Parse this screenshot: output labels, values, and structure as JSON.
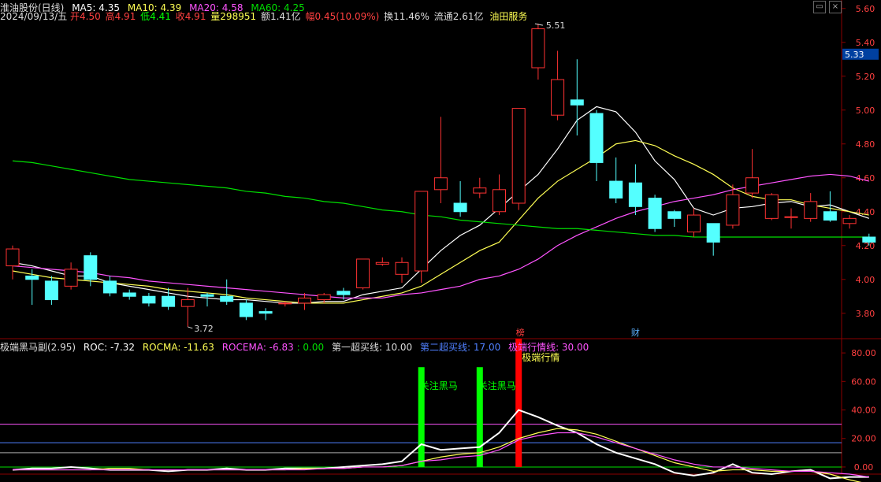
{
  "header": {
    "stock_name": "淮油股份(日线)",
    "ma5": "MA5: 4.35",
    "ma10": "MA10: 4.39",
    "ma20": "MA20: 4.58",
    "ma60": "MA60: 4.25",
    "date": "2024/09/13/五",
    "open": "开4.50",
    "high": "高4.91",
    "low": "低4.41",
    "close": "收4.91",
    "volume": "量298951",
    "amount": "额1.41亿",
    "change": "幅0.45(10.09%)",
    "turnover": "换11.46%",
    "float_cap": "流通2.61亿",
    "sector": "油田服务"
  },
  "indicator_header": {
    "name": "极端黑马副(2.95)",
    "roc": "ROC: -7.32",
    "rocma": "ROCMA: -11.63",
    "rocema": "ROCEMA: -6.83",
    "zero": ": 0.00",
    "first_buy": "第一超买线: 10.00",
    "second_buy": "第二超买线: 17.00",
    "extreme": "极端行情线: 30.00"
  },
  "price_axis_labels": [
    "5.60",
    "5.40",
    "5.20",
    "5.00",
    "4.80",
    "4.60",
    "4.40",
    "4.20",
    "4.00",
    "3.80"
  ],
  "indicator_axis_labels": [
    "80.00",
    "60.00",
    "40.00",
    "20.00",
    "0.00"
  ],
  "current_price_tag": "5.33",
  "annotations": {
    "high_label": "5.51",
    "low_label": "3.72",
    "marker_bang": "榜",
    "marker_cai": "财",
    "signal_1": "关注黑马",
    "signal_2": "关注黑马",
    "signal_3": "极端行情"
  },
  "colors": {
    "bg": "#000000",
    "up": "#ff3232",
    "down": "#54ffff",
    "ma5": "#ffffff",
    "ma10": "#ffff54",
    "ma20": "#ff54ff",
    "ma60": "#00e000",
    "grid": "#8b0000",
    "axis_text": "#ff4040",
    "title_text": "#dddddd"
  },
  "chart_data": [
    {
      "type": "candlestick",
      "title": "淮油股份(日线)",
      "ylim": [
        3.65,
        5.65
      ],
      "candles": [
        {
          "o": 4.08,
          "c": 4.18,
          "h": 4.2,
          "l": 4.0
        },
        {
          "o": 4.02,
          "c": 4.0,
          "h": 4.06,
          "l": 3.85
        },
        {
          "o": 3.99,
          "c": 3.88,
          "h": 4.02,
          "l": 3.85
        },
        {
          "o": 3.96,
          "c": 4.06,
          "h": 4.1,
          "l": 3.94
        },
        {
          "o": 4.14,
          "c": 4.0,
          "h": 4.16,
          "l": 3.96
        },
        {
          "o": 3.99,
          "c": 3.92,
          "h": 4.02,
          "l": 3.9
        },
        {
          "o": 3.92,
          "c": 3.9,
          "h": 3.94,
          "l": 3.88
        },
        {
          "o": 3.9,
          "c": 3.86,
          "h": 3.92,
          "l": 3.84
        },
        {
          "o": 3.9,
          "c": 3.84,
          "h": 3.95,
          "l": 3.82
        },
        {
          "o": 3.84,
          "c": 3.88,
          "h": 3.95,
          "l": 3.72
        },
        {
          "o": 3.91,
          "c": 3.9,
          "h": 3.92,
          "l": 3.84
        },
        {
          "o": 3.9,
          "c": 3.87,
          "h": 4.0,
          "l": 3.85
        },
        {
          "o": 3.86,
          "c": 3.78,
          "h": 3.88,
          "l": 3.76
        },
        {
          "o": 3.81,
          "c": 3.8,
          "h": 3.83,
          "l": 3.76
        },
        {
          "o": 3.86,
          "c": 3.86,
          "h": 3.87,
          "l": 3.84
        },
        {
          "o": 3.86,
          "c": 3.89,
          "h": 3.92,
          "l": 3.82
        },
        {
          "o": 3.88,
          "c": 3.91,
          "h": 3.92,
          "l": 3.86
        },
        {
          "o": 3.93,
          "c": 3.91,
          "h": 3.95,
          "l": 3.88
        },
        {
          "o": 3.95,
          "c": 4.12,
          "h": 4.12,
          "l": 3.94
        },
        {
          "o": 4.09,
          "c": 4.1,
          "h": 4.13,
          "l": 4.08
        },
        {
          "o": 4.03,
          "c": 4.1,
          "h": 4.13,
          "l": 3.98
        },
        {
          "o": 4.05,
          "c": 4.52,
          "h": 4.52,
          "l": 3.98
        },
        {
          "o": 4.53,
          "c": 4.6,
          "h": 4.96,
          "l": 4.45
        },
        {
          "o": 4.45,
          "c": 4.4,
          "h": 4.58,
          "l": 4.37
        },
        {
          "o": 4.51,
          "c": 4.54,
          "h": 4.6,
          "l": 4.48
        },
        {
          "o": 4.4,
          "c": 4.53,
          "h": 4.62,
          "l": 4.38
        },
        {
          "o": 4.45,
          "c": 5.01,
          "h": 5.01,
          "l": 4.41
        },
        {
          "o": 5.25,
          "c": 5.48,
          "h": 5.51,
          "l": 5.18
        },
        {
          "o": 4.97,
          "c": 5.18,
          "h": 5.35,
          "l": 4.94
        },
        {
          "o": 5.06,
          "c": 5.03,
          "h": 5.3,
          "l": 4.85
        },
        {
          "o": 4.98,
          "c": 4.69,
          "h": 5.0,
          "l": 4.58
        },
        {
          "o": 4.58,
          "c": 4.48,
          "h": 4.72,
          "l": 4.45
        },
        {
          "o": 4.57,
          "c": 4.43,
          "h": 4.68,
          "l": 4.38
        },
        {
          "o": 4.48,
          "c": 4.3,
          "h": 4.5,
          "l": 4.28
        },
        {
          "o": 4.4,
          "c": 4.36,
          "h": 4.41,
          "l": 4.31
        },
        {
          "o": 4.28,
          "c": 4.38,
          "h": 4.42,
          "l": 4.25
        },
        {
          "o": 4.33,
          "c": 4.22,
          "h": 4.33,
          "l": 4.14
        },
        {
          "o": 4.32,
          "c": 4.5,
          "h": 4.56,
          "l": 4.3
        },
        {
          "o": 4.51,
          "c": 4.6,
          "h": 4.77,
          "l": 4.48
        },
        {
          "o": 4.36,
          "c": 4.5,
          "h": 4.51,
          "l": 4.35
        },
        {
          "o": 4.37,
          "c": 4.37,
          "h": 4.42,
          "l": 4.3
        },
        {
          "o": 4.36,
          "c": 4.46,
          "h": 4.51,
          "l": 4.34
        },
        {
          "o": 4.4,
          "c": 4.35,
          "h": 4.52,
          "l": 4.34
        },
        {
          "o": 4.33,
          "c": 4.36,
          "h": 4.38,
          "l": 4.3
        },
        {
          "o": 4.25,
          "c": 4.22,
          "h": 4.27,
          "l": 4.2
        }
      ],
      "ma_series": [
        {
          "name": "MA5",
          "values": [
            4.1,
            4.08,
            4.05,
            4.02,
            4.02,
            3.98,
            3.96,
            3.94,
            3.92,
            3.9,
            3.89,
            3.88,
            3.88,
            3.87,
            3.86,
            3.86,
            3.87,
            3.87,
            3.91,
            3.93,
            3.95,
            4.06,
            4.17,
            4.26,
            4.32,
            4.42,
            4.52,
            4.62,
            4.77,
            4.94,
            5.02,
            4.99,
            4.87,
            4.7,
            4.59,
            4.42,
            4.38,
            4.42,
            4.43,
            4.45,
            4.46,
            4.43,
            4.44,
            4.4,
            4.36
          ]
        },
        {
          "name": "MA10",
          "values": [
            4.05,
            4.03,
            4.01,
            4.0,
            3.99,
            3.98,
            3.97,
            3.96,
            3.94,
            3.93,
            3.92,
            3.91,
            3.89,
            3.88,
            3.87,
            3.86,
            3.86,
            3.86,
            3.88,
            3.9,
            3.92,
            3.96,
            4.03,
            4.1,
            4.17,
            4.22,
            4.35,
            4.48,
            4.58,
            4.65,
            4.72,
            4.8,
            4.82,
            4.79,
            4.73,
            4.68,
            4.62,
            4.54,
            4.49,
            4.47,
            4.47,
            4.44,
            4.42,
            4.4,
            4.38
          ]
        },
        {
          "name": "MA20",
          "values": [
            4.08,
            4.07,
            4.06,
            4.05,
            4.04,
            4.02,
            4.01,
            3.99,
            3.98,
            3.97,
            3.96,
            3.95,
            3.94,
            3.93,
            3.92,
            3.91,
            3.9,
            3.89,
            3.89,
            3.89,
            3.91,
            3.92,
            3.94,
            3.96,
            4.0,
            4.02,
            4.06,
            4.12,
            4.2,
            4.26,
            4.31,
            4.36,
            4.4,
            4.43,
            4.46,
            4.48,
            4.5,
            4.53,
            4.55,
            4.57,
            4.59,
            4.61,
            4.62,
            4.61,
            4.58
          ]
        },
        {
          "name": "MA60",
          "values": [
            4.7,
            4.69,
            4.67,
            4.65,
            4.63,
            4.61,
            4.59,
            4.58,
            4.57,
            4.56,
            4.55,
            4.54,
            4.52,
            4.51,
            4.49,
            4.48,
            4.46,
            4.45,
            4.43,
            4.41,
            4.4,
            4.38,
            4.37,
            4.35,
            4.34,
            4.33,
            4.32,
            4.31,
            4.3,
            4.3,
            4.29,
            4.28,
            4.27,
            4.26,
            4.26,
            4.25,
            4.25,
            4.25,
            4.25,
            4.25,
            4.25,
            4.25,
            4.25,
            4.25,
            4.25
          ]
        }
      ]
    },
    {
      "type": "line",
      "title": "极端黑马副(2.95)",
      "ylim": [
        -5,
        90
      ],
      "thresholds": [
        {
          "name": "第一超买线",
          "value": 10
        },
        {
          "name": "第二超买线",
          "value": 17
        },
        {
          "name": "极端行情线",
          "value": 30
        }
      ],
      "series": [
        {
          "name": "ROC",
          "values": [
            -2,
            -1,
            -1,
            0,
            -1,
            -2,
            -2,
            -2,
            -3,
            -2,
            -2,
            -1,
            -2,
            -2,
            -1,
            -1,
            -1,
            0,
            1,
            2,
            4,
            16,
            12,
            13,
            14,
            24,
            40,
            35,
            29,
            24,
            16,
            10,
            6,
            2,
            -4,
            -6,
            -4,
            2,
            -4,
            -5,
            -3,
            -2,
            -8,
            -7,
            -7
          ]
        },
        {
          "name": "ROCMA",
          "values": [
            -2,
            -2,
            -2,
            -2,
            -2,
            -1,
            -1,
            -2,
            -2,
            -2,
            -2,
            -2,
            -2,
            -2,
            -2,
            -1,
            -1,
            -1,
            0,
            0,
            1,
            4,
            7,
            9,
            10,
            14,
            20,
            24,
            27,
            26,
            23,
            18,
            13,
            8,
            3,
            0,
            -3,
            -2,
            -2,
            -3,
            -3,
            -3,
            -5,
            -9,
            -12
          ]
        },
        {
          "name": "ROCEMA",
          "values": [
            -2,
            -2,
            -2,
            -2,
            -2,
            -2,
            -2,
            -2,
            -2,
            -2,
            -2,
            -2,
            -2,
            -2,
            -2,
            -2,
            -1,
            -1,
            0,
            0,
            1,
            4,
            5,
            7,
            8,
            12,
            19,
            22,
            24,
            24,
            21,
            17,
            13,
            9,
            5,
            2,
            0,
            0,
            -1,
            -2,
            -3,
            -3,
            -4,
            -5,
            -7
          ]
        }
      ],
      "signal_bars": [
        {
          "index": 21,
          "value": 70,
          "label": "关注黑马",
          "color": "#00ff00"
        },
        {
          "index": 24,
          "value": 70,
          "label": "关注黑马",
          "color": "#00ff00"
        },
        {
          "index": 26,
          "value": 90,
          "label": "极端行情",
          "color": "#ff0000"
        }
      ]
    }
  ]
}
